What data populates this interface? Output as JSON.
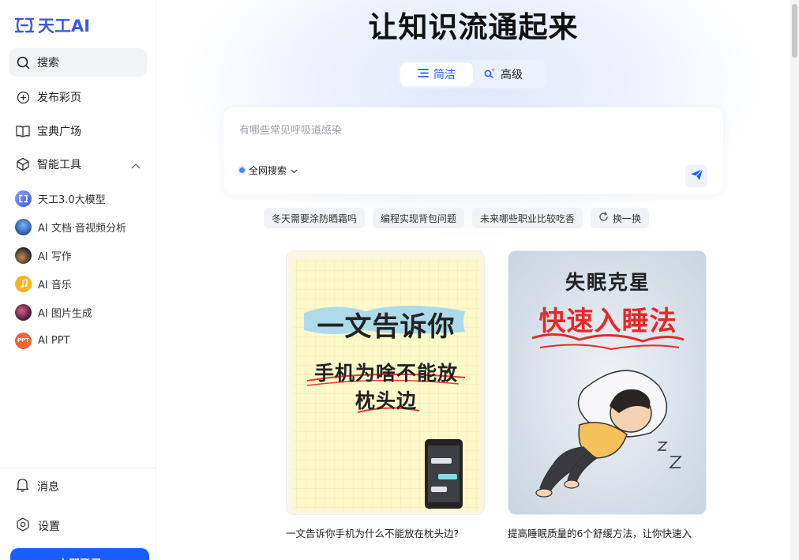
{
  "brand": {
    "name": "天工AI"
  },
  "sidebar": {
    "nav": [
      {
        "label": "搜索",
        "icon": "search-icon",
        "active": true
      },
      {
        "label": "发布彩页",
        "icon": "plus-circle-icon"
      },
      {
        "label": "宝典广场",
        "icon": "book-icon"
      },
      {
        "label": "智能工具",
        "icon": "cube-icon",
        "expanded": true
      }
    ],
    "tools": [
      {
        "label": "天工3.0大模型",
        "icon": "tiangong-model-avatar"
      },
      {
        "label": "AI 文档·音视频分析",
        "icon": "doc-analysis-avatar"
      },
      {
        "label": "AI 写作",
        "icon": "writing-avatar"
      },
      {
        "label": "AI 音乐",
        "icon": "music-avatar"
      },
      {
        "label": "AI 图片生成",
        "icon": "image-gen-avatar"
      },
      {
        "label": "AI PPT",
        "icon": "ppt-avatar",
        "badge": "PPT"
      }
    ],
    "bottom": [
      {
        "label": "消息",
        "icon": "bell-icon"
      },
      {
        "label": "设置",
        "icon": "gear-icon"
      }
    ],
    "login_label": "立即登录"
  },
  "main": {
    "headline": "让知识流通起来",
    "modes": [
      {
        "label": "简洁",
        "active": true
      },
      {
        "label": "高级",
        "active": false
      }
    ],
    "search": {
      "placeholder": "有哪些常见呼吸道感染",
      "scope": "全网搜索"
    },
    "suggestions": [
      "冬天需要涂防晒霜吗",
      "编程实现背包问题",
      "未来哪些职业比较吃香"
    ],
    "refresh_label": "换一换",
    "cards": [
      {
        "title": "一文告诉你手机为什么不能放在枕头边?",
        "image_text": {
          "heading": "一文告诉你",
          "line1": "手机为啥不能放",
          "line2": "枕头边"
        }
      },
      {
        "title": "提高睡眠质量的6个舒缓方法，让你快速入",
        "image_text": {
          "heading": "失眠克星",
          "line1": "快速入睡法"
        }
      }
    ]
  },
  "colors": {
    "accent": "#1a5cff",
    "brand": "#3b5bdb"
  }
}
